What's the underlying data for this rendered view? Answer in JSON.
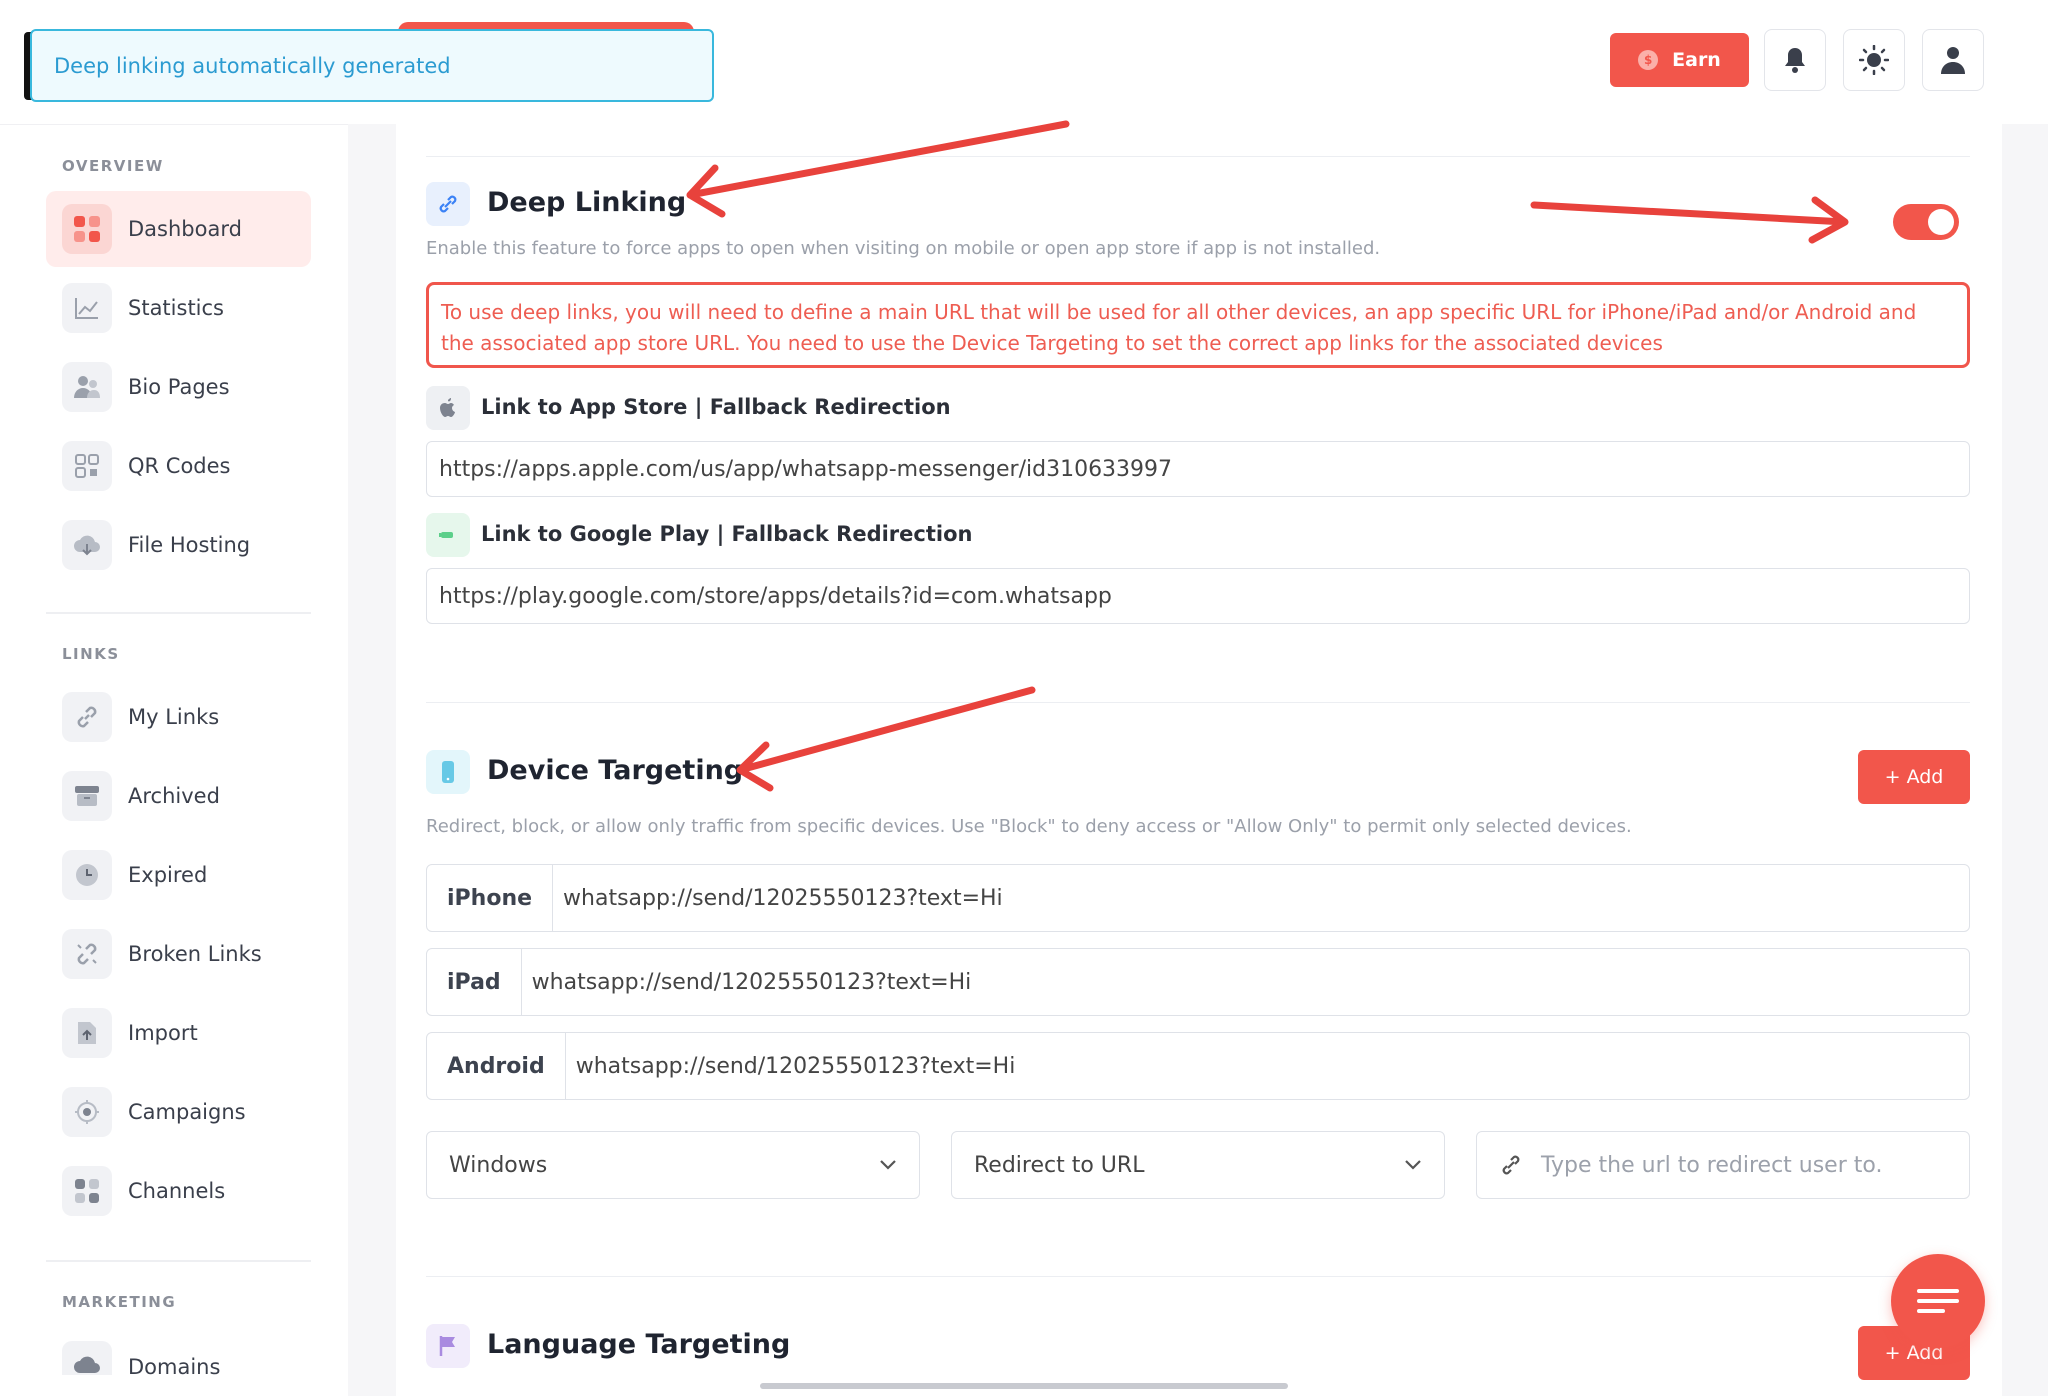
{
  "toast": {
    "message": "Deep linking automatically generated"
  },
  "header": {
    "earn_label": "Earn",
    "earn_coin": "$",
    "icons": [
      "bell-icon",
      "sun-icon",
      "user-icon"
    ]
  },
  "sidebar": {
    "overview_label": "OVERVIEW",
    "links_label": "LINKS",
    "marketing_label": "MARKETING",
    "overview_items": [
      {
        "label": "Dashboard",
        "icon": "dashboard-icon",
        "active": true
      },
      {
        "label": "Statistics",
        "icon": "chart-icon"
      },
      {
        "label": "Bio Pages",
        "icon": "users-icon"
      },
      {
        "label": "QR Codes",
        "icon": "qr-icon"
      },
      {
        "label": "File Hosting",
        "icon": "cloud-icon"
      }
    ],
    "link_items": [
      {
        "label": "My Links",
        "icon": "link-icon"
      },
      {
        "label": "Archived",
        "icon": "archive-icon"
      },
      {
        "label": "Expired",
        "icon": "clock-icon"
      },
      {
        "label": "Broken Links",
        "icon": "broken-link-icon"
      },
      {
        "label": "Import",
        "icon": "import-icon"
      },
      {
        "label": "Campaigns",
        "icon": "target-icon"
      },
      {
        "label": "Channels",
        "icon": "grid-icon"
      }
    ],
    "marketing_items": [
      {
        "label": "Domains",
        "icon": "cloud-icon"
      }
    ]
  },
  "deep_linking": {
    "title": "Deep Linking",
    "description": "Enable this feature to force apps to open when visiting on mobile or open app store if app is not installed.",
    "enabled": true,
    "alert_line1": "To use deep links, you will need to define a main URL that will be used for all other devices, an app specific URL for iPhone/iPad and/or Android and",
    "alert_line2": "the associated app store URL. You need to use the Device Targeting to set the correct app links for the associated devices",
    "app_store_label": "Link to App Store | Fallback Redirection",
    "app_store_url": "https://apps.apple.com/us/app/whatsapp-messenger/id310633997",
    "google_play_label": "Link to Google Play | Fallback Redirection",
    "google_play_url": "https://play.google.com/store/apps/details?id=com.whatsapp"
  },
  "device_targeting": {
    "title": "Device Targeting",
    "add_label": "+ Add",
    "description": "Redirect, block, or allow only traffic from specific devices. Use \"Block\" to deny access or \"Allow Only\" to permit only selected devices.",
    "rows": [
      {
        "device": "iPhone",
        "url": "whatsapp://send/12025550123?text=Hi"
      },
      {
        "device": "iPad",
        "url": "whatsapp://send/12025550123?text=Hi"
      },
      {
        "device": "Android",
        "url": "whatsapp://send/12025550123?text=Hi"
      }
    ],
    "device_select": "Windows",
    "action_select": "Redirect to URL",
    "url_placeholder": "Type the url to redirect user to."
  },
  "language_targeting": {
    "title": "Language Targeting",
    "add_label": "+ Add"
  },
  "colors": {
    "accent": "#f2564b",
    "toast": "#2b9bd1"
  }
}
